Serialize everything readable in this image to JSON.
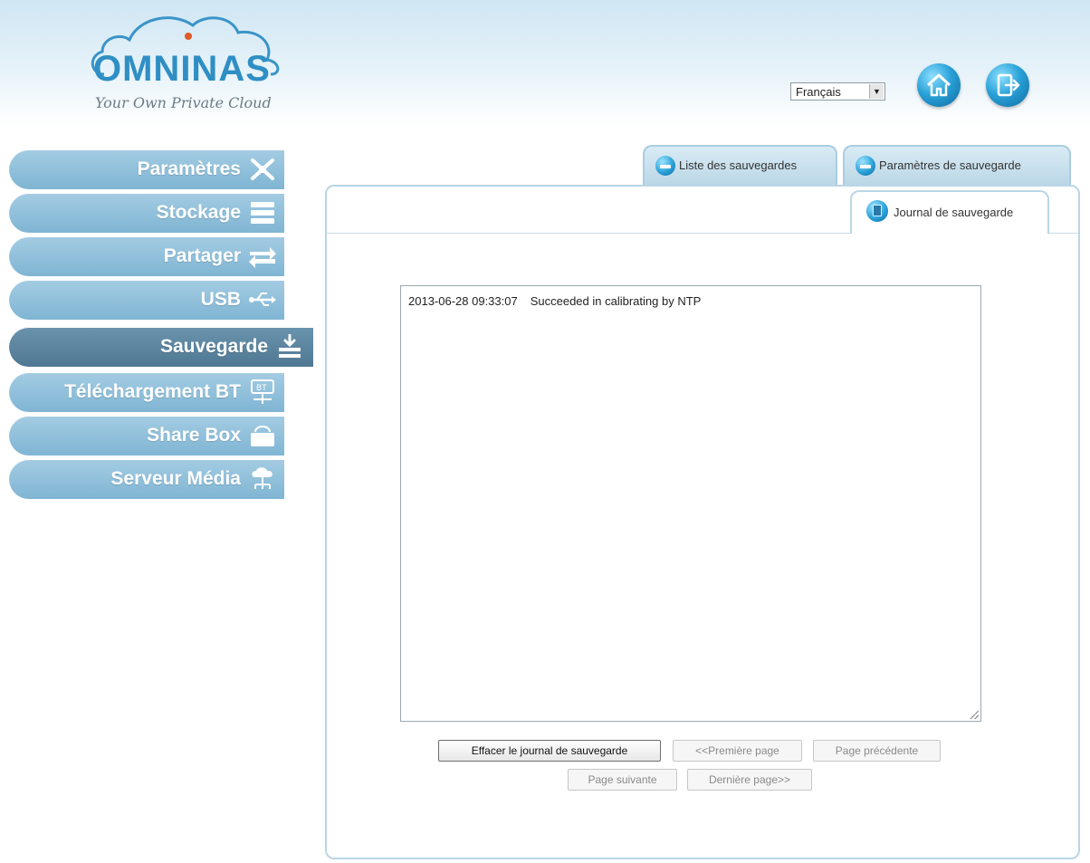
{
  "header": {
    "logo_text": "OMNINAS",
    "logo_tagline": "Your Own Private Cloud",
    "language_selected": "Français",
    "home_icon": "home-icon",
    "logout_icon": "logout-icon"
  },
  "sidebar": {
    "items": [
      {
        "label": "Paramètres",
        "icon": "tools-icon",
        "active": false
      },
      {
        "label": "Stockage",
        "icon": "storage-icon",
        "active": false
      },
      {
        "label": "Partager",
        "icon": "share-arrows-icon",
        "active": false
      },
      {
        "label": "USB",
        "icon": "usb-icon",
        "active": false
      },
      {
        "label": "Sauvegarde",
        "icon": "backup-download-icon",
        "active": true
      },
      {
        "label": "Téléchargement BT",
        "icon": "bt-download-icon",
        "active": false
      },
      {
        "label": "Share Box",
        "icon": "sharebox-icon",
        "active": false
      },
      {
        "label": "Serveur Média",
        "icon": "media-server-icon",
        "active": false
      }
    ]
  },
  "tabs": {
    "top": [
      "Liste des sauvegardes",
      "Paramètres de sauvegarde"
    ],
    "active": "Journal de sauvegarde"
  },
  "log": {
    "entries": [
      {
        "timestamp": "2013-06-28 09:33:07",
        "message": "Succeeded in calibrating by NTP"
      }
    ]
  },
  "buttons": {
    "clear_log": "Effacer le journal de sauvegarde",
    "first_page": "<<Première page",
    "prev_page": "Page précédente",
    "next_page": "Page suivante",
    "last_page": "Dernière page>>"
  },
  "colors": {
    "accent": "#2aa2d9",
    "sidebar_item": "#8fbfd9",
    "sidebar_active": "#5a8299",
    "logo": "#2f8fc4"
  }
}
